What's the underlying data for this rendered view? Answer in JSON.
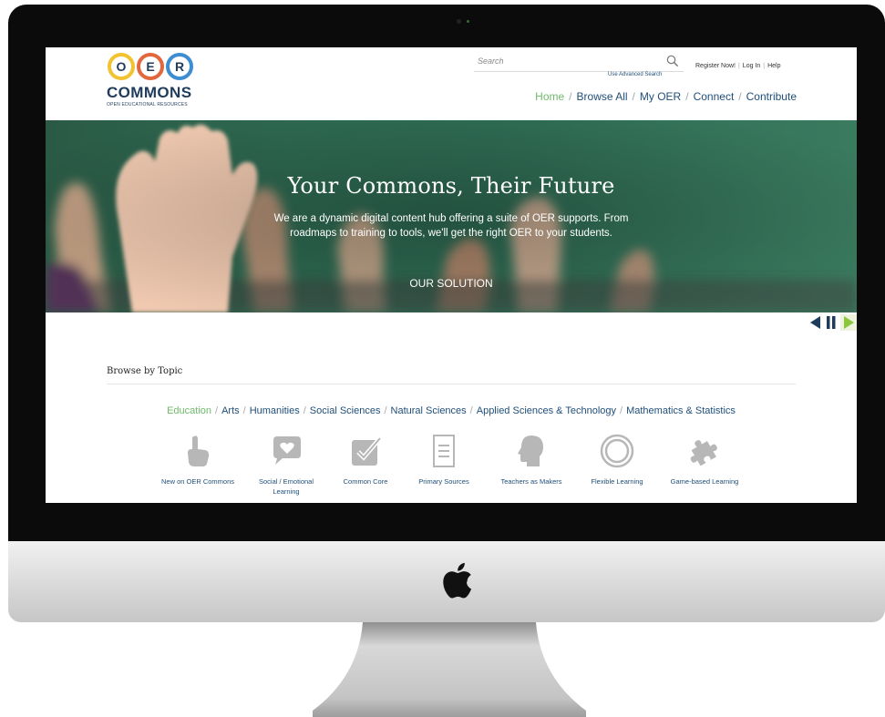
{
  "site": {
    "logo": {
      "letters": [
        "O",
        "E",
        "R"
      ],
      "wordmark": "COMMONS",
      "tagline": "OPEN EDUCATIONAL RESOURCES"
    },
    "search": {
      "placeholder": "Search",
      "icon": "magnifier-icon",
      "advanced_link": "Use Advanced Search"
    },
    "user_links": [
      "Register Now!",
      "Log In",
      "Help"
    ],
    "nav": [
      {
        "label": "Home",
        "active": true
      },
      {
        "label": "Browse All",
        "active": false
      },
      {
        "label": "My OER",
        "active": false
      },
      {
        "label": "Connect",
        "active": false
      },
      {
        "label": "Contribute",
        "active": false
      }
    ],
    "hero": {
      "title": "Your Commons, Their Future",
      "text": "We are a dynamic digital content hub offering a suite of OER supports. From roadmaps to training to tools, we'll get the right OER to your students.",
      "cta": "OUR SOLUTION"
    },
    "slider_controls": [
      "previous-icon",
      "pause-icon",
      "next-icon"
    ],
    "browse": {
      "heading": "Browse by Topic",
      "topics": [
        {
          "label": "Education",
          "active": true
        },
        {
          "label": "Arts",
          "active": false
        },
        {
          "label": "Humanities",
          "active": false
        },
        {
          "label": "Social Sciences",
          "active": false
        },
        {
          "label": "Natural Sciences",
          "active": false
        },
        {
          "label": "Applied Sciences & Technology",
          "active": false
        },
        {
          "label": "Mathematics & Statistics",
          "active": false
        }
      ],
      "items": [
        {
          "label": "New on OER Commons",
          "icon": "pointing-hand-icon"
        },
        {
          "label": "Social / Emotional Learning",
          "icon": "speech-bubble-heart-icon"
        },
        {
          "label": "Common Core",
          "icon": "checkbox-icon"
        },
        {
          "label": "Primary Sources",
          "icon": "document-icon"
        },
        {
          "label": "Teachers as Makers",
          "icon": "head-profile-icon"
        },
        {
          "label": "Flexible Learning",
          "icon": "concentric-circles-icon"
        },
        {
          "label": "Game-based Learning",
          "icon": "puzzle-piece-icon"
        }
      ]
    }
  },
  "colors": {
    "navy": "#1f4e79",
    "green_accent": "#6fba6a",
    "icon_gray": "#b7b7b7",
    "hero_green": "#2f6d55"
  }
}
